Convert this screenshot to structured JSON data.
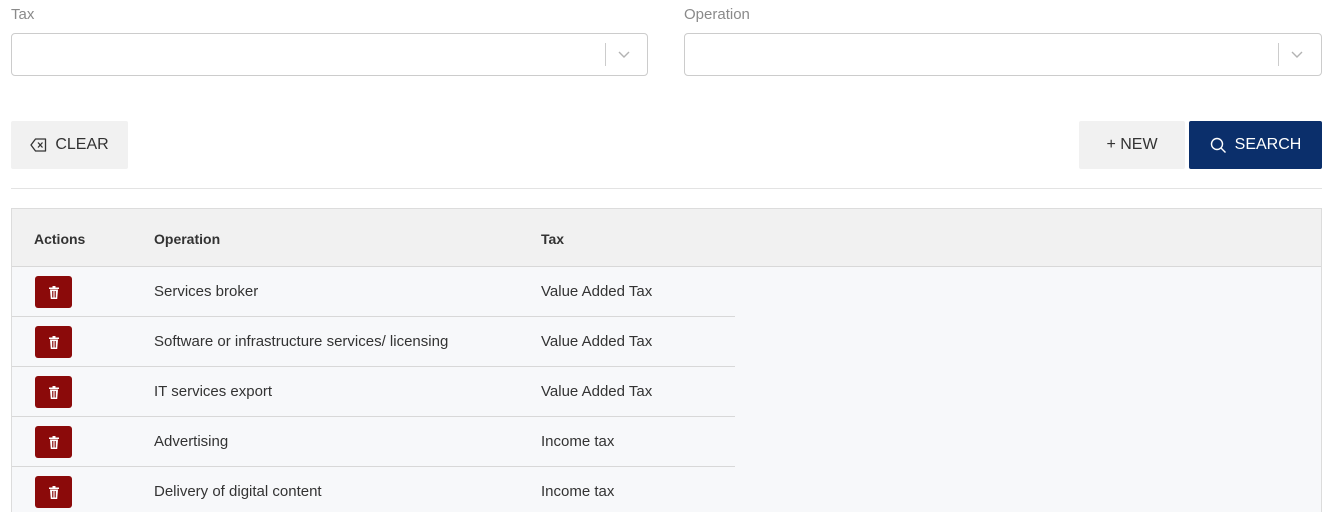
{
  "filters": {
    "tax": {
      "label": "Tax",
      "value": ""
    },
    "operation": {
      "label": "Operation",
      "value": ""
    }
  },
  "toolbar": {
    "clear_label": "CLEAR",
    "new_label": "+ NEW",
    "search_label": "SEARCH"
  },
  "table": {
    "headers": {
      "actions": "Actions",
      "operation": "Operation",
      "tax": "Tax"
    },
    "rows": [
      {
        "operation": "Services broker",
        "tax": "Value Added Tax"
      },
      {
        "operation": "Software or infrastructure services/ licensing",
        "tax": "Value Added Tax"
      },
      {
        "operation": "IT services export",
        "tax": "Value Added Tax"
      },
      {
        "operation": "Advertising",
        "tax": "Income tax"
      },
      {
        "operation": "Delivery of digital content",
        "tax": "Income tax"
      }
    ]
  },
  "icons": {
    "clear": "backspace-icon",
    "search": "search-icon",
    "delete": "trash-icon",
    "dropdown": "chevron-down-icon"
  },
  "colors": {
    "primary": "#0b2f6b",
    "delete": "#8b0a0a"
  }
}
